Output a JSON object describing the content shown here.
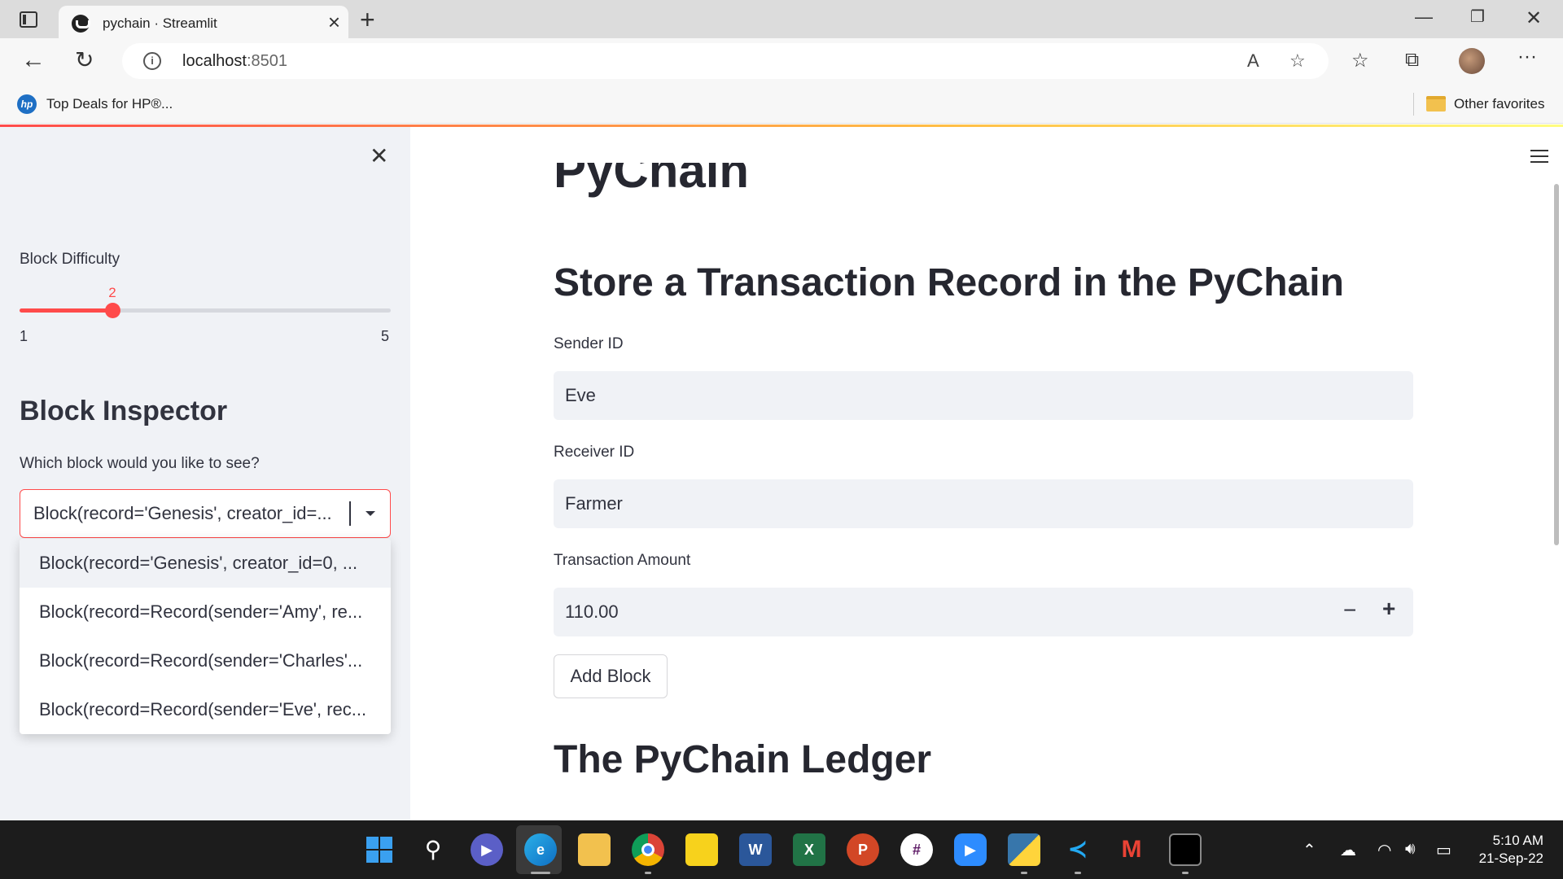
{
  "browser": {
    "tab_title": "pychain · Streamlit",
    "url_host": "localhost",
    "url_port": ":8501",
    "favorites": [
      {
        "label": "Top Deals for HP®..."
      }
    ],
    "other_favorites": "Other favorites"
  },
  "sidebar": {
    "difficulty_label": "Block Difficulty",
    "difficulty": {
      "value": "2",
      "min": "1",
      "max": "5",
      "fraction": 0.25
    },
    "inspector_title": "Block Inspector",
    "inspector_question": "Which block would you like to see?",
    "selected": "Block(record='Genesis', creator_id=...",
    "options": [
      "Block(record='Genesis', creator_id=0, ...",
      "Block(record=Record(sender='Amy', re...",
      "Block(record=Record(sender='Charles'...",
      "Block(record=Record(sender='Eve', rec..."
    ]
  },
  "main": {
    "app_title": "PyChain",
    "section_title": "Store a Transaction Record in the PyChain",
    "sender_label": "Sender ID",
    "sender_value": "Eve",
    "receiver_label": "Receiver ID",
    "receiver_value": "Farmer",
    "amount_label": "Transaction Amount",
    "amount_value": "110.00",
    "add_block_label": "Add Block",
    "ledger_title": "The PyChain Ledger"
  },
  "taskbar": {
    "time": "5:10 AM",
    "date": "21-Sep-22"
  },
  "colors": {
    "accent": "#ff4b4b",
    "sidebar_bg": "#f0f2f6",
    "input_bg": "#f0f2f6",
    "text": "#31333f"
  }
}
